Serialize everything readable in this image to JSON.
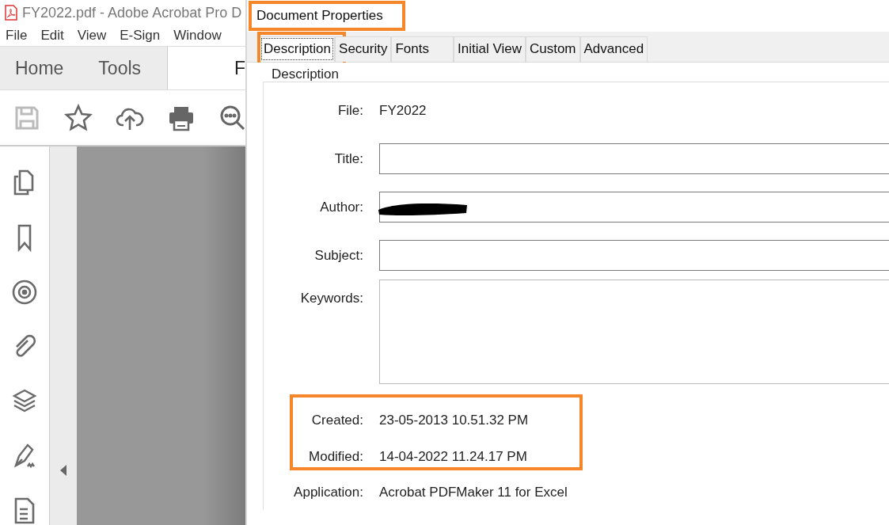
{
  "app": {
    "title": "FY2022.pdf - Adobe Acrobat Pro D",
    "menu": [
      "File",
      "Edit",
      "View",
      "E-Sign",
      "Window"
    ],
    "tabs": [
      {
        "label": "Home",
        "selected": false
      },
      {
        "label": "Tools",
        "selected": false
      },
      {
        "label": "F",
        "selected": true
      }
    ],
    "toolbar": [
      {
        "kind": "save",
        "disabled": true
      },
      {
        "kind": "star",
        "disabled": false
      },
      {
        "kind": "upload",
        "disabled": false
      },
      {
        "kind": "print",
        "disabled": false
      },
      {
        "kind": "search",
        "disabled": false
      }
    ],
    "sidebar": [
      {
        "kind": "pages"
      },
      {
        "kind": "bookmark"
      },
      {
        "kind": "target"
      },
      {
        "kind": "attachment"
      },
      {
        "kind": "layers"
      },
      {
        "kind": "sign"
      },
      {
        "kind": "document"
      }
    ]
  },
  "dialog": {
    "title": "Document Properties",
    "title_highlighted": true,
    "tabs": [
      {
        "label": "Description",
        "selected": true,
        "highlighted": true
      },
      {
        "label": "Security",
        "selected": false,
        "highlighted": false
      },
      {
        "label": "Fonts",
        "selected": false,
        "highlighted": false
      },
      {
        "label": "Initial View",
        "selected": false,
        "highlighted": false
      },
      {
        "label": "Custom",
        "selected": false,
        "highlighted": false
      },
      {
        "label": "Advanced",
        "selected": false,
        "highlighted": false
      }
    ],
    "group_title": "Description",
    "fields": [
      {
        "kind": "text",
        "label": "File:",
        "value": "FY2022"
      },
      {
        "kind": "input",
        "label": "Title:"
      },
      {
        "kind": "input",
        "label": "Author:",
        "redacted": true
      },
      {
        "kind": "input",
        "label": "Subject:"
      },
      {
        "kind": "area",
        "label": "Keywords:"
      }
    ],
    "dates": {
      "highlighted": true,
      "items": [
        {
          "label": "Created:",
          "value": "23-05-2013 10.51.32 PM"
        },
        {
          "label": "Modified:",
          "value": "14-04-2022 11.24.17 PM"
        }
      ]
    },
    "application": {
      "label": "Application:",
      "value": "Acrobat PDFMaker 11 for Excel"
    }
  }
}
